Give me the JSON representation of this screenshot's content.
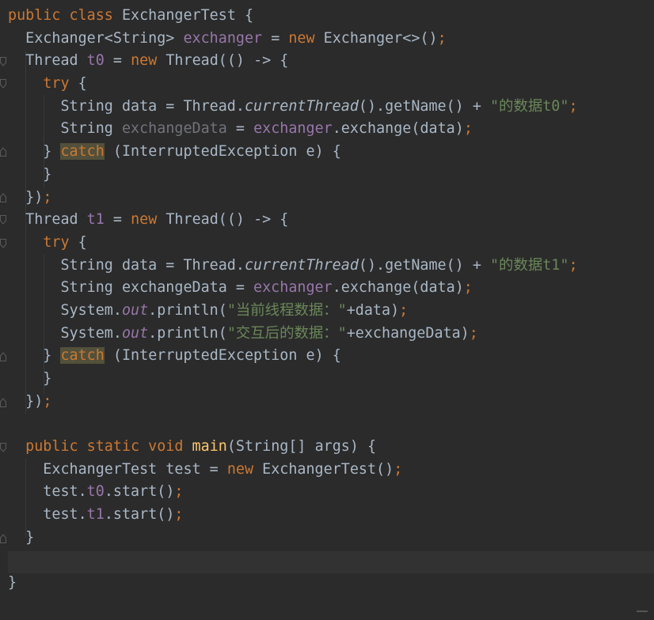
{
  "colors": {
    "background": "#2b2b2b",
    "keyword": "#cc7832",
    "field": "#9876aa",
    "string": "#6a8759",
    "method_decl": "#ffc66d",
    "default_text": "#a9b7c6",
    "unused": "#72737a",
    "caret_line": "#323232"
  },
  "code": {
    "l1": [
      "public class",
      "ExchangerTest {"
    ],
    "l2": [
      "Exchanger<String>",
      "exchanger",
      "=",
      "new",
      "Exchanger<>()",
      ";"
    ],
    "l3": [
      "Thread",
      "t0",
      "=",
      "new",
      "Thread(() -> {"
    ],
    "l4": [
      "try",
      "{"
    ],
    "l5": [
      "String data = Thread.",
      "currentThread",
      "().getName() + ",
      "\"的数据t0\"",
      ";"
    ],
    "l6": [
      "String",
      "exchangeData",
      "=",
      "exchanger",
      ".exchange(data)",
      ";"
    ],
    "l7": [
      "}",
      "catch",
      "(InterruptedException e) {"
    ],
    "l8": [
      "}"
    ],
    "l9": [
      "})",
      ";"
    ],
    "l10": [
      "Thread",
      "t1",
      "=",
      "new",
      "Thread(() -> {"
    ],
    "l11": [
      "try",
      "{"
    ],
    "l12": [
      "String data = Thread.",
      "currentThread",
      "().getName() + ",
      "\"的数据t1\"",
      ";"
    ],
    "l13": [
      "String exchangeData =",
      "exchanger",
      ".exchange(data)",
      ";"
    ],
    "l14": [
      "System.",
      "out",
      ".println(",
      "\"当前线程数据：\"",
      "+data)",
      ";"
    ],
    "l15": [
      "System.",
      "out",
      ".println(",
      "\"交互后的数据：\"",
      "+exchangeData)",
      ";"
    ],
    "l16": [
      "}",
      "catch",
      "(InterruptedException e) {"
    ],
    "l17": [
      "}"
    ],
    "l18": [
      "})",
      ";"
    ],
    "l19": [
      ""
    ],
    "l20": [
      "public static void",
      "main",
      "(String[] args) {"
    ],
    "l21": [
      "ExchangerTest test =",
      "new",
      "ExchangerTest()",
      ";"
    ],
    "l22": [
      "test.",
      "t0",
      ".start()",
      ";"
    ],
    "l23": [
      "test.",
      "t1",
      ".start()",
      ";"
    ],
    "l24": [
      "}"
    ],
    "l25": [
      ""
    ],
    "l26": [
      "}"
    ]
  }
}
